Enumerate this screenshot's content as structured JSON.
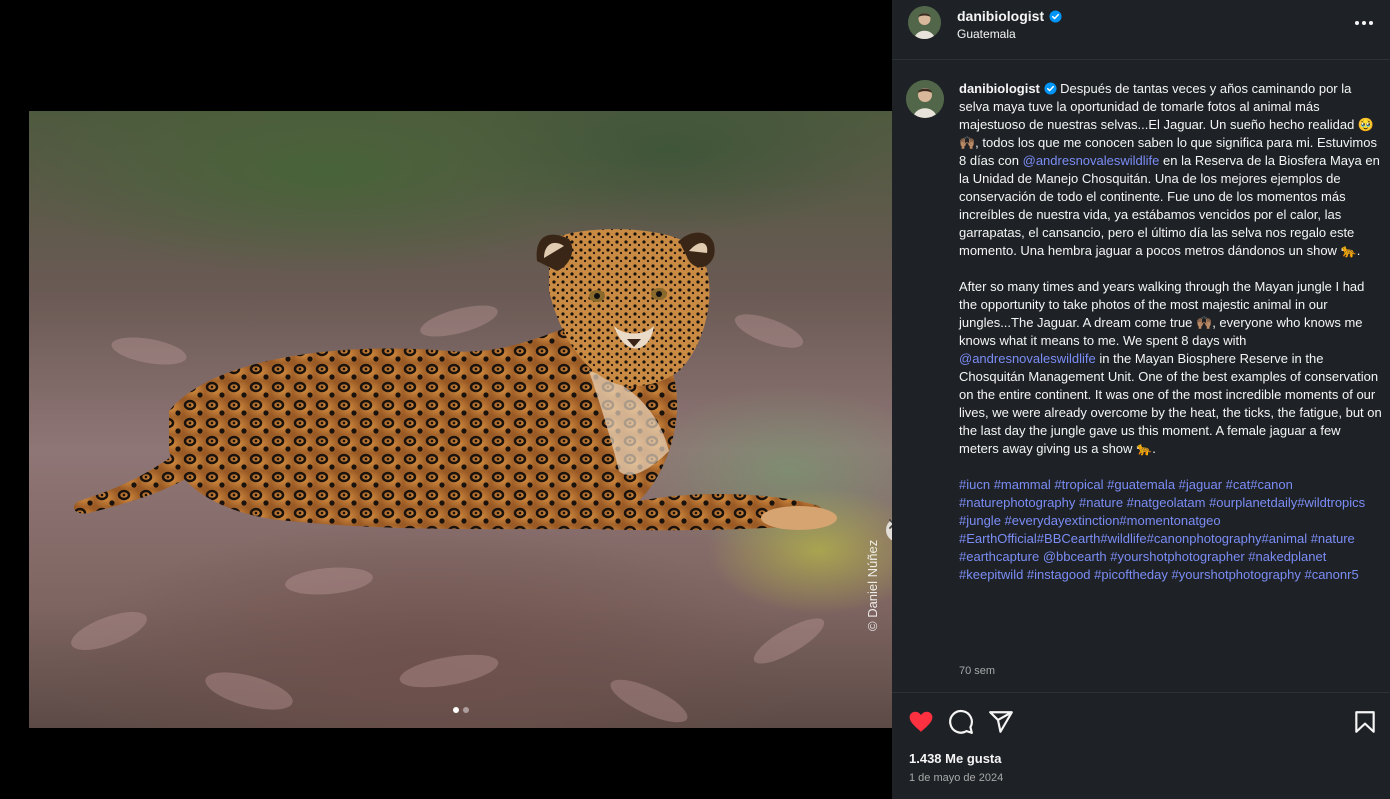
{
  "photo": {
    "credit": "© Daniel Núñez",
    "carousel_dots": 2,
    "active_dot": 0
  },
  "header": {
    "username": "danibiologist",
    "location": "Guatemala"
  },
  "caption": {
    "username": "danibiologist",
    "spanish_text": "Después de tantas veces y años caminando por la selva maya tuve la oportunidad de tomarle fotos al animal más majestuoso de nuestras selvas...El Jaguar. Un sueño hecho realidad 🥹🙌🏽, todos los que me conocen saben lo que significa para mi. Estuvimos 8 días con",
    "spanish_mention": "@andresnovaleswildlife",
    "spanish_text_2": "en la Reserva de la Biosfera Maya en la Unidad de Manejo Chosquitán. Una de los mejores ejemplos de conservación de todo el continente. Fue uno de los momentos más increíbles de nuestra vida, ya estábamos vencidos por el calor, las garrapatas, el cansancio, pero el último día las selva nos regalo este momento. Una hembra jaguar a pocos metros dándonos un show 🐆.",
    "english_text": "After so many times and years walking through the Mayan jungle I had the opportunity to take photos of the most majestic animal in our jungles...The Jaguar. A dream come true 🙌🏽, everyone who knows me knows what it means to me. We spent 8 days with",
    "english_mention": "@andresnovaleswildlife",
    "english_text_2": "in the Mayan Biosphere Reserve in the Chosquitán Management Unit. One of the best examples of conservation on the entire continent. It was one of the most incredible moments of our lives, we were already overcome by the heat, the ticks, the fatigue, but on the last day the jungle gave us this moment. A female jaguar a few meters away giving us a show 🐆.",
    "hashtags": "#iucn #mammal #tropical #guatemala #jaguar #cat#canon #naturephotography #nature #natgeolatam #ourplanetdaily#wildtropics #jungle #everydayextinction#momentonatgeo #EarthOfficial#BBCearth#wildlife#canonphotography#animal #nature #earthcapture @bbcearth #yourshotphotographer #nakedplanet #keepitwild #instagood #picoftheday #yourshotphotography #canonr5",
    "time_ago": "70 sem"
  },
  "actions": {
    "likes": "1.438 Me gusta",
    "date": "1 de mayo de 2024",
    "liked": true,
    "like_color": "#ff3040"
  },
  "icons": [
    "verified-badge-icon",
    "more-options-icon",
    "heart-icon",
    "comment-icon",
    "share-icon",
    "bookmark-icon",
    "chevron-right-icon"
  ]
}
